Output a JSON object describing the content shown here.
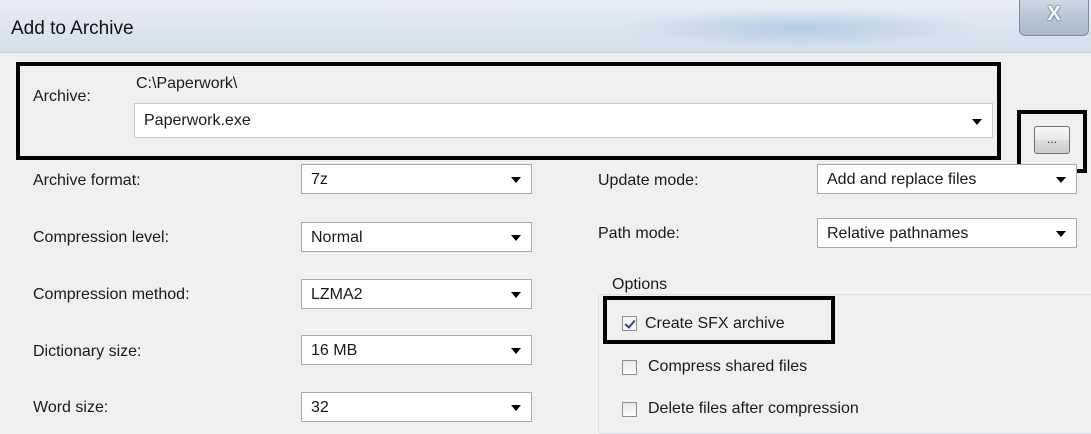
{
  "window": {
    "title": "Add to Archive",
    "close_label": "X"
  },
  "archive": {
    "label": "Archive:",
    "path": "C:\\Paperwork\\",
    "filename": "Paperwork.exe",
    "browse_label": "..."
  },
  "left_fields": [
    {
      "label": "Archive format:",
      "value": "7z"
    },
    {
      "label": "Compression level:",
      "value": "Normal"
    },
    {
      "label": "Compression method:",
      "value": "LZMA2"
    },
    {
      "label": "Dictionary size:",
      "value": "16 MB"
    },
    {
      "label": "Word size:",
      "value": "32"
    }
  ],
  "right_fields": [
    {
      "label": "Update mode:",
      "value": "Add and replace files"
    },
    {
      "label": "Path mode:",
      "value": "Relative pathnames"
    }
  ],
  "options": {
    "group_label": "Options",
    "items": [
      {
        "label": "Create SFX archive",
        "checked": true
      },
      {
        "label": "Compress shared files",
        "checked": false
      },
      {
        "label": "Delete files after compression",
        "checked": false
      }
    ]
  }
}
